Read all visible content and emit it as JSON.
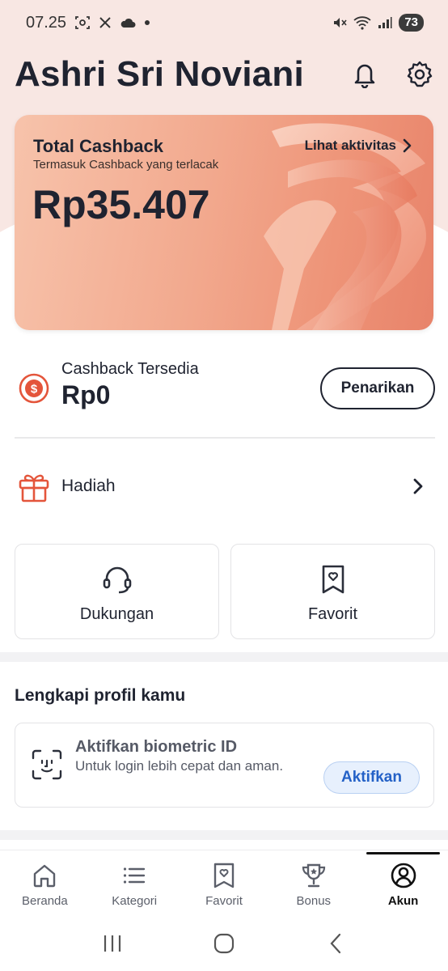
{
  "status_bar": {
    "time": "07.25",
    "battery": "73"
  },
  "header": {
    "name": "Ashri Sri Noviani"
  },
  "cashback_card": {
    "title": "Total Cashback",
    "subtitle": "Termasuk Cashback yang terlacak",
    "amount": "Rp35.407",
    "link_label": "Lihat aktivitas"
  },
  "available": {
    "label": "Cashback Tersedia",
    "amount": "Rp0",
    "button_label": "Penarikan"
  },
  "gift": {
    "label": "Hadiah"
  },
  "tiles": [
    {
      "label": "Dukungan",
      "icon": "headset-icon"
    },
    {
      "label": "Favorit",
      "icon": "bookmark-heart-icon"
    }
  ],
  "profile_section": {
    "title": "Lengkapi profil kamu",
    "biometric_title": "Aktifkan biometric ID",
    "biometric_desc": "Untuk login lebih cepat dan aman.",
    "activate_label": "Aktifkan"
  },
  "bottom_nav": [
    {
      "label": "Beranda",
      "icon": "home-icon",
      "active": false
    },
    {
      "label": "Kategori",
      "icon": "list-icon",
      "active": false
    },
    {
      "label": "Favorit",
      "icon": "bookmark-heart-icon",
      "active": false
    },
    {
      "label": "Bonus",
      "icon": "trophy-icon",
      "active": false
    },
    {
      "label": "Akun",
      "icon": "account-icon",
      "active": true
    }
  ],
  "colors": {
    "accent_red": "#e4553b",
    "text_dark": "#1f2330",
    "link_blue": "#2461c7"
  }
}
